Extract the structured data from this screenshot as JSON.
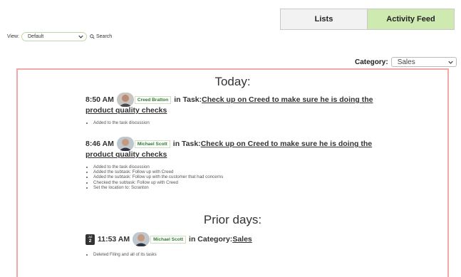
{
  "tabs": [
    {
      "label": "Lists"
    },
    {
      "label": "Activity Feed"
    }
  ],
  "viewbar": {
    "label": "View:",
    "selected": "Default",
    "search_label": "Search"
  },
  "category": {
    "label": "Category:",
    "selected": "Sales"
  },
  "today": {
    "title": "Today:",
    "entries": [
      {
        "time": "8:50 AM",
        "user": "Creed Bratton",
        "context": "in Task:",
        "target_line1": "Check up on Creed to make sure he is doing the",
        "target_line2": "product quality checks",
        "details": [
          "Added to the task discussion"
        ]
      },
      {
        "time": "8:46 AM",
        "user": "Michael Scott",
        "context": "in Task:",
        "target_line1": "Check up on Creed to make sure he is doing the",
        "target_line2": "product quality checks",
        "details": [
          "Added to the task discussion",
          "Added the subtask: Follow up with Creed",
          "Added the subtask: Follow up with the customer that had concerns",
          "Checked the subtask: Follow up with Creed",
          "Set the location to: Scranton"
        ]
      }
    ]
  },
  "prior": {
    "title": "Prior days:",
    "entries": [
      {
        "date_month": "Jul",
        "date_day": "2",
        "time": "11:53 AM",
        "user": "Michael Scott",
        "context": "in Category:",
        "target": "Sales",
        "details": [
          "Deleted Filing and all of its tasks"
        ]
      }
    ]
  },
  "colors": {
    "active_tab": "#cfeab0",
    "feed_border": "#f2a8a8",
    "user_tag_text": "#2f7a2f"
  },
  "icons": {
    "search": "search-icon",
    "dropdown": "chevron-down-icon"
  }
}
